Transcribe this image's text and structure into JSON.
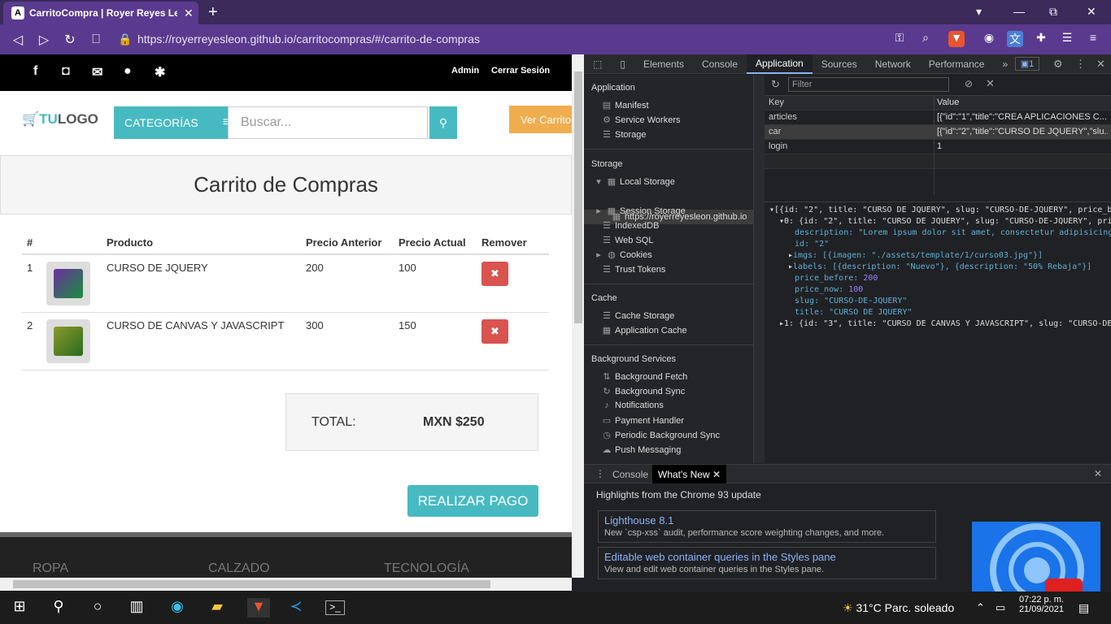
{
  "browser": {
    "tab_title": "CarritoCompra | Royer Reyes León",
    "tab_icon": "A",
    "url": "https://royerreyesleon.github.io/carritocompras/#/carrito-de-compras",
    "new_tab": "+",
    "window_controls": [
      "▾",
      "—",
      "⧉",
      "✕"
    ]
  },
  "site": {
    "admin_label": "Admin",
    "logout_label": "Cerrar Sesión",
    "logo_prefix": "TU",
    "logo_suffix": "LOGO",
    "categories_label": "CATEGORÍAS",
    "search_placeholder": "Buscar...",
    "cart_button": "Ver Carrito",
    "page_title": "Carrito de Compras",
    "table_headers": [
      "#",
      "",
      "Producto",
      "Precio Anterior",
      "Precio Actual",
      "Remover"
    ],
    "rows": [
      {
        "num": "1",
        "product": "CURSO DE JQUERY",
        "price_before": "200",
        "price_now": "100"
      },
      {
        "num": "2",
        "product": "CURSO DE CANVAS Y JAVASCRIPT",
        "price_before": "300",
        "price_now": "150"
      }
    ],
    "total_label": "TOTAL:",
    "total_value": "MXN $250",
    "pay_button": "REALIZAR PAGO",
    "footer_categories": [
      "ROPA",
      "CALZADO",
      "TECNOLOGÍA"
    ]
  },
  "devtools": {
    "tabs": [
      "Elements",
      "Console",
      "Application",
      "Sources",
      "Network",
      "Performance"
    ],
    "active_tab": "Application",
    "more_tabs": "»",
    "badge": "1",
    "sidebar": {
      "application_header": "Application",
      "application_items": [
        "Manifest",
        "Service Workers",
        "Storage"
      ],
      "storage_header": "Storage",
      "local_storage": "Local Storage",
      "local_storage_origin": "https://royerreyesleon.github.io",
      "storage_items": [
        "Session Storage",
        "IndexedDB",
        "Web SQL",
        "Cookies",
        "Trust Tokens"
      ],
      "cache_header": "Cache",
      "cache_items": [
        "Cache Storage",
        "Application Cache"
      ],
      "bg_header": "Background Services",
      "bg_items": [
        "Background Fetch",
        "Background Sync",
        "Notifications",
        "Payment Handler",
        "Periodic Background Sync",
        "Push Messaging"
      ]
    },
    "filter_placeholder": "Filter",
    "kv_headers": {
      "key": "Key",
      "value": "Value"
    },
    "kv_rows": [
      {
        "key": "articles",
        "value": "[{\"id\":\"1\",\"title\":\"CREA APLICACIONES C..."
      },
      {
        "key": "car",
        "value": "[{\"id\":\"2\",\"title\":\"CURSO DE JQUERY\",\"slu..."
      },
      {
        "key": "login",
        "value": "1"
      }
    ],
    "json_lines": {
      "l0": "[{id: \"2\", title: \"CURSO DE JQUERY\", slug: \"CURSO-DE-JQUERY\", price_b",
      "l1": "0: {id: \"2\", title: \"CURSO DE JQUERY\", slug: \"CURSO-DE-JQUERY\", pric",
      "l2k": "description:",
      "l2v": "\"Lorem ipsum dolor sit amet, consectetur adipisicing",
      "l3k": "id:",
      "l3v": "\"2\"",
      "l4": "imgs: [{imagen: \"./assets/template/1/curso03.jpg\"}]",
      "l5": "labels: [{description: \"Nuevo\"}, {description: \"50% Rebaja\"}]",
      "l6k": "price_before:",
      "l6v": "200",
      "l7k": "price_now:",
      "l7v": "100",
      "l8k": "slug:",
      "l8v": "\"CURSO-DE-JQUERY\"",
      "l9k": "title:",
      "l9v": "\"CURSO DE JQUERY\"",
      "l10": "1: {id: \"3\", title: \"CURSO DE CANVAS Y JAVASCRIPT\", slug: \"CURSO-DE-"
    },
    "drawer": {
      "tabs": [
        "Console",
        "What's New"
      ],
      "active": "What's New",
      "highlights": "Highlights from the Chrome 93 update",
      "cards": [
        {
          "title": "Lighthouse 8.1",
          "desc": "New `csp-xss` audit, performance score weighting changes, and more."
        },
        {
          "title": "Editable web container queries in the Styles pane",
          "desc": "View and edit web container queries in the Styles pane."
        }
      ]
    }
  },
  "taskbar": {
    "weather": "31°C  Parc. soleado",
    "time": "07:22 p. m.",
    "date": "21/09/2021"
  },
  "colors": {
    "accent": "#47bac1",
    "brand_purple": "#5a3a8e",
    "danger": "#d9534f",
    "warning": "#f0ad4e"
  }
}
